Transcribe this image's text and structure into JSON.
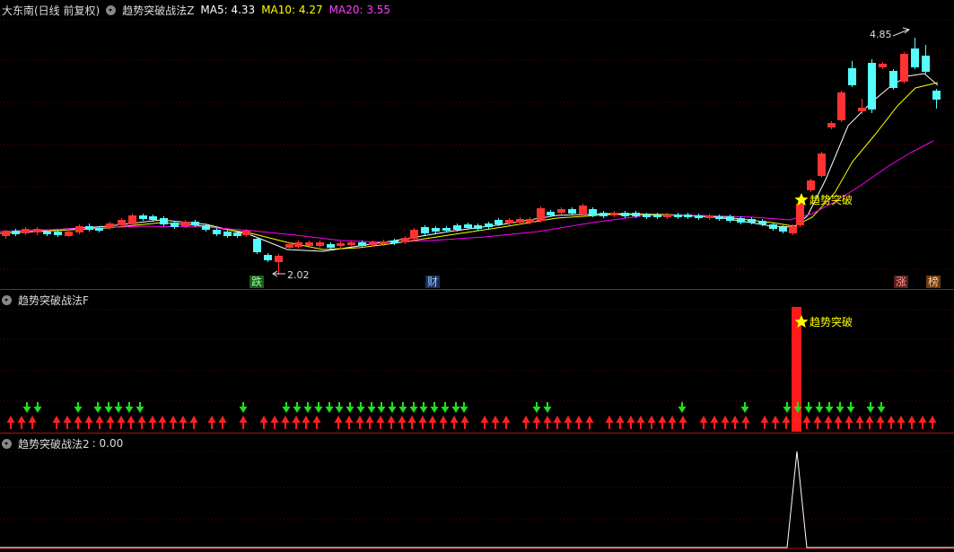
{
  "main": {
    "stock_label": "大东南(日线 前复权)",
    "indicator_name": "趋势突破战法Z",
    "ma5_label": "MA5: 4.33",
    "ma10_label": "MA10: 4.27",
    "ma20_label": "MA20: 3.55",
    "high_price": "4.85",
    "low_price": "2.02",
    "signal_label": "趋势突破",
    "tags": {
      "die": "跌",
      "cai": "财",
      "zhang": "涨",
      "bang": "榜"
    }
  },
  "sub1": {
    "title": "趋势突破战法F",
    "signal_label": "趋势突破"
  },
  "sub2": {
    "title": "趋势突破战法2",
    "value_label": ": 0.00"
  },
  "colors": {
    "up": "#ff3232",
    "down": "#54fcfc",
    "ma5": "#ffffff",
    "ma10": "#ffff00",
    "ma20": "#ff00ff",
    "signal": "#ffff00",
    "arrow_up": "#ff2020",
    "arrow_down": "#20e020",
    "grid": "#7a0000",
    "separator": "#b01010"
  },
  "icons": [
    "collapse-circle-icon",
    "star-icon",
    "up-arrow-icon",
    "down-arrow-icon"
  ]
}
